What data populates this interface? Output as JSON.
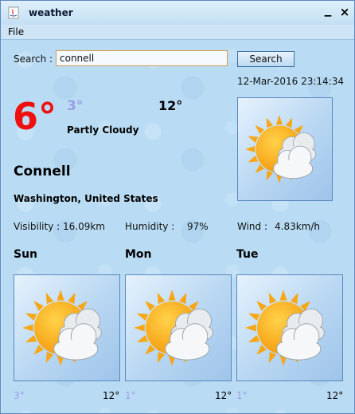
{
  "window": {
    "title": "weather",
    "icon": "java-app-icon"
  },
  "menu": {
    "file_label": "File"
  },
  "search": {
    "label": "Search :",
    "value": "connell",
    "button_label": "Search"
  },
  "datetime": "12-Mar-2016 23:14:34",
  "current": {
    "temp": "6°",
    "low": "3°",
    "high": "12°",
    "condition": "Partly Cloudy",
    "icon": "partly-cloudy-icon"
  },
  "location": {
    "city": "Connell",
    "region": "Washington, United States"
  },
  "stats": {
    "visibility_label": "Visibility :",
    "visibility_value": "16.09km",
    "humidity_label": "Humidity :",
    "humidity_value": "97%",
    "wind_label": "Wind :",
    "wind_value": "4.83km/h"
  },
  "forecast": [
    {
      "day": "Sun",
      "low": "3°",
      "high": "12°",
      "icon": "partly-cloudy-icon"
    },
    {
      "day": "Mon",
      "low": "1°",
      "high": "12°",
      "icon": "partly-cloudy-icon"
    },
    {
      "day": "Tue",
      "low": "1°",
      "high": "12°",
      "icon": "partly-cloudy-icon"
    }
  ],
  "colors": {
    "current_temp": "#ee1010",
    "low_temp": "#9c9ce8",
    "background": "#b9dcf4"
  }
}
